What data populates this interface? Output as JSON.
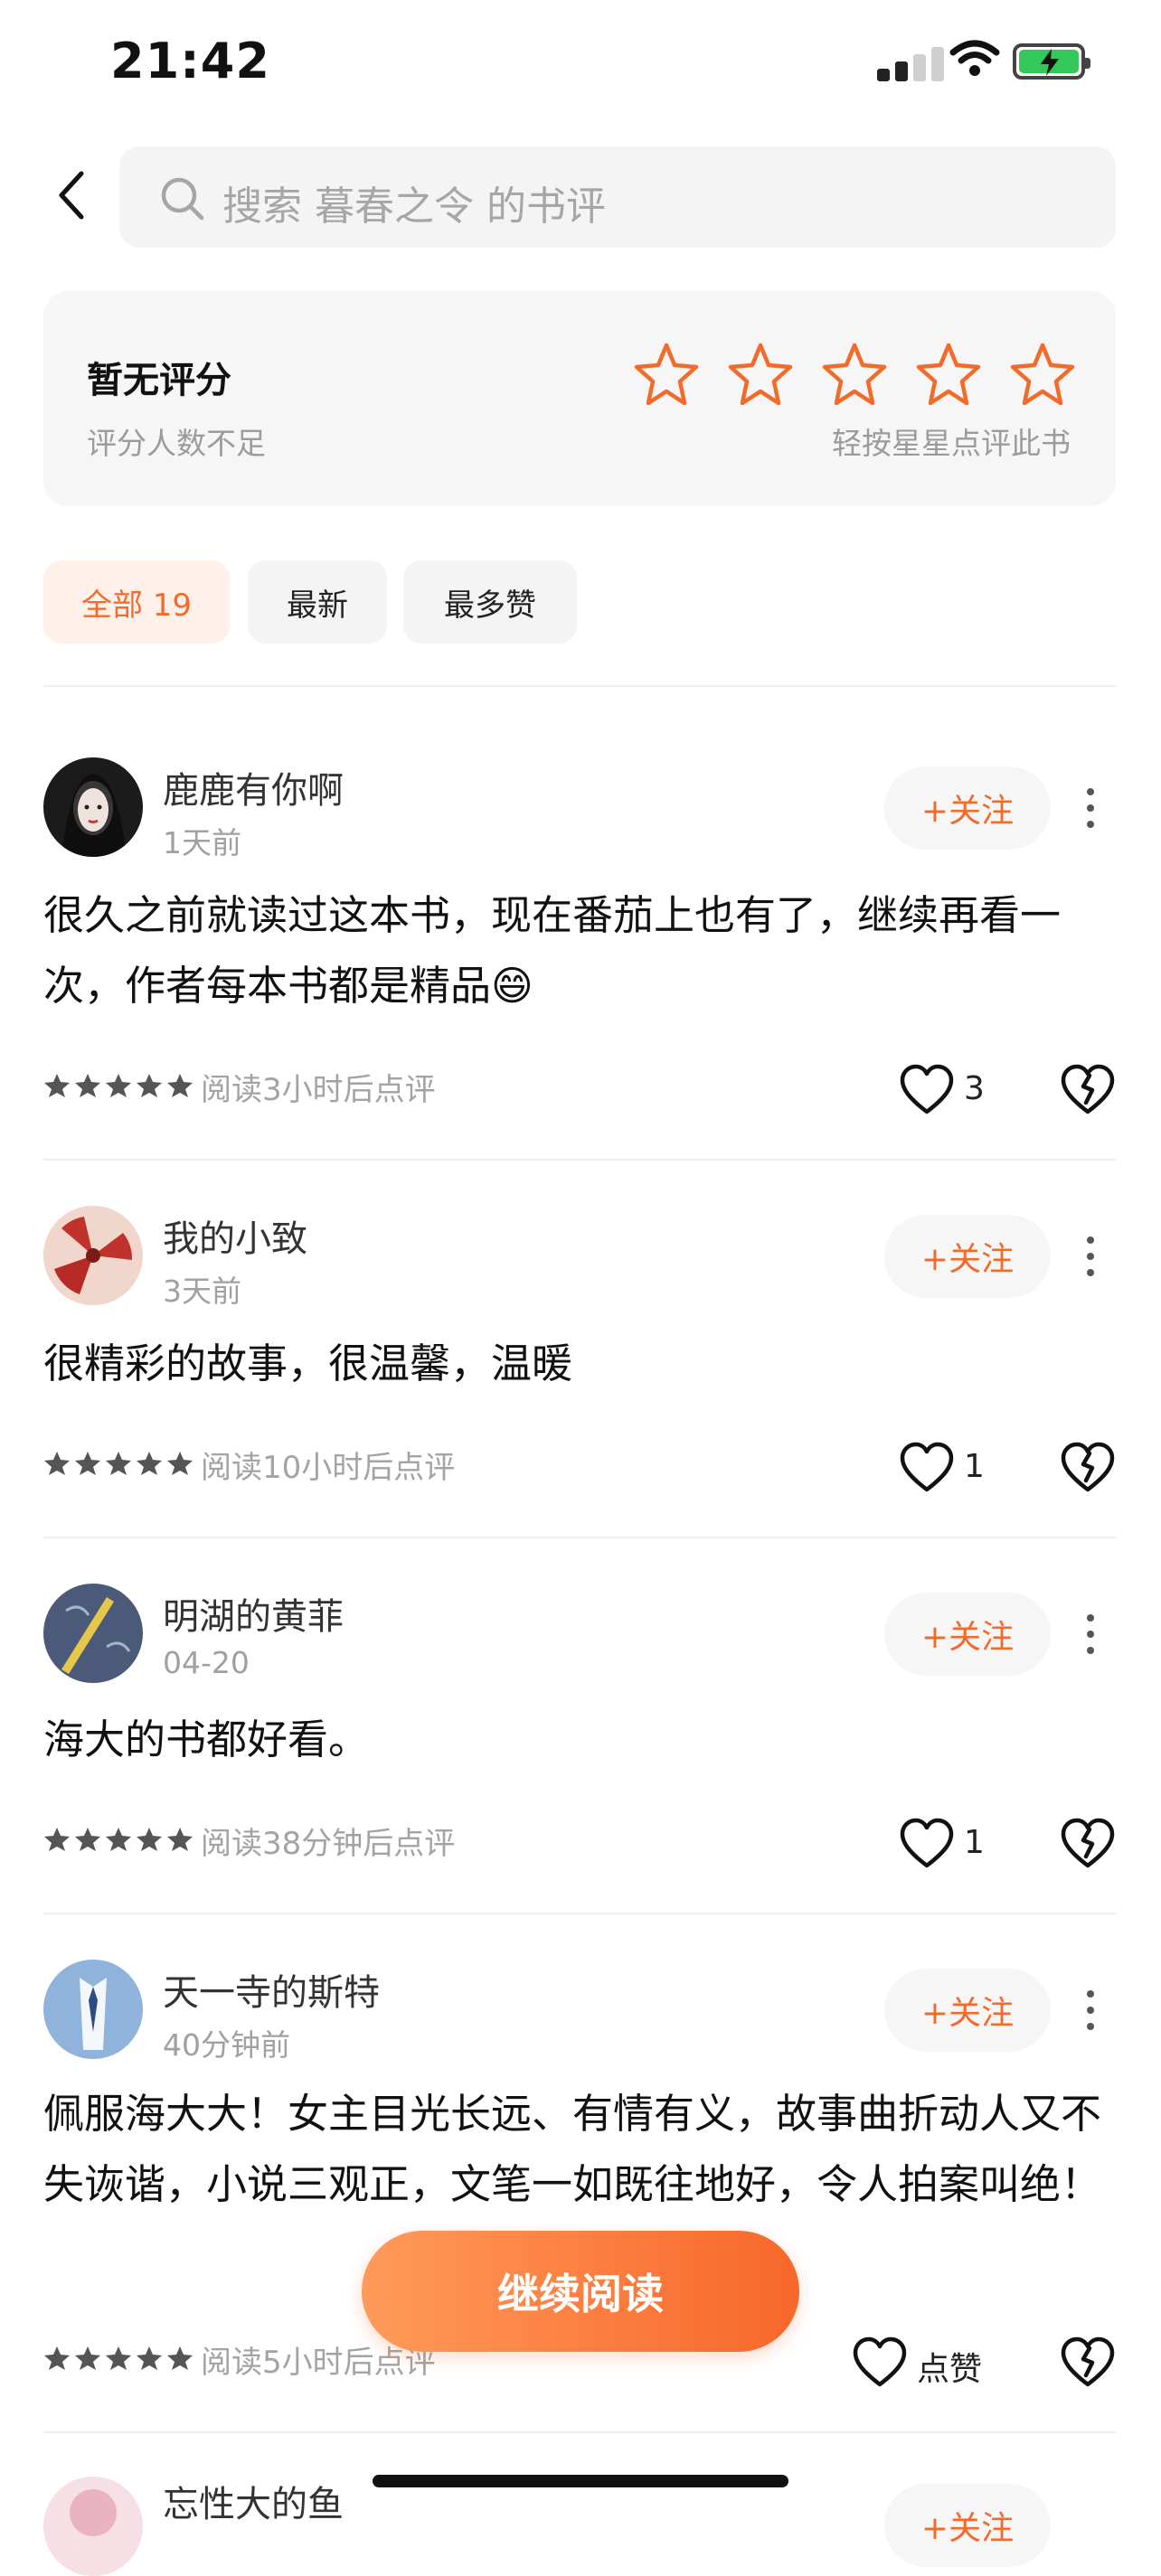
{
  "status_bar": {
    "time": "21:42"
  },
  "header": {
    "search_placeholder": "搜索 暮春之令 的书评"
  },
  "rating_card": {
    "title": "暂无评分",
    "subtitle": "评分人数不足",
    "hint": "轻按星星点评此书",
    "star_color": "#f26b2a"
  },
  "tabs": [
    {
      "label": "全部 19",
      "active": true
    },
    {
      "label": "最新",
      "active": false
    },
    {
      "label": "最多赞",
      "active": false
    }
  ],
  "reviews": [
    {
      "user": "鹿鹿有你啊",
      "time": "1天前",
      "follow": "+关注",
      "text": "很久之前就读过这本书，现在番茄上也有了，继续再看一次，作者每本书都是精品😄",
      "meta": "阅读3小时后点评",
      "likes": "3",
      "stars": 5
    },
    {
      "user": "我的小致",
      "time": "3天前",
      "follow": "+关注",
      "text": "很精彩的故事，很温馨，温暖",
      "meta": "阅读10小时后点评",
      "likes": "1",
      "stars": 5
    },
    {
      "user": "明湖的黄菲",
      "time": "04-20",
      "follow": "+关注",
      "text": "海大的书都好看。",
      "meta": "阅读38分钟后点评",
      "likes": "1",
      "stars": 5
    },
    {
      "user": "天一寺的斯特",
      "time": "40分钟前",
      "follow": "+关注",
      "text": "佩服海大大！女主目光长远、有情有义，故事曲折动人又不失诙谐，小说三观正，文笔一如既往地好，令人拍案叫绝！",
      "meta": "阅读5小时后点评",
      "likes": "点赞",
      "stars": 5
    },
    {
      "user": "忘性大的鱼",
      "follow": "+关注"
    }
  ],
  "cta": {
    "label": "继续阅读"
  },
  "colors": {
    "accent": "#f26b2a",
    "tab_active_bg": "#fff1ea"
  }
}
